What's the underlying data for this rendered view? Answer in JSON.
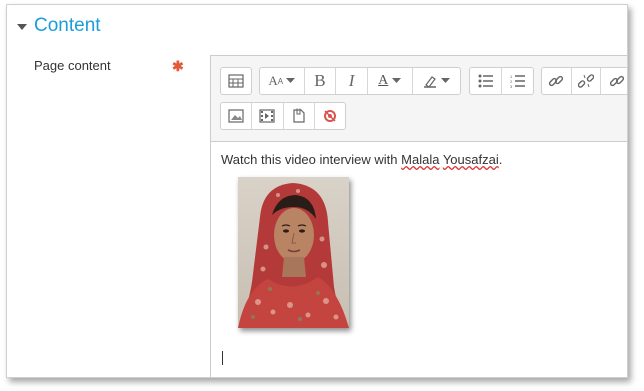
{
  "section": {
    "title": "Content"
  },
  "field": {
    "label": "Page content",
    "required_marker": "✱"
  },
  "toolbar": {
    "row1": [
      {
        "name": "show-more-buttons-icon"
      },
      {
        "name": "font-size-icon",
        "label": "A"
      },
      {
        "name": "bold-icon",
        "label": "B"
      },
      {
        "name": "italic-icon",
        "label": "I"
      },
      {
        "name": "font-color-icon",
        "label": "A"
      },
      {
        "name": "background-color-icon"
      },
      {
        "name": "unordered-list-icon"
      },
      {
        "name": "ordered-list-icon"
      },
      {
        "name": "link-icon"
      },
      {
        "name": "unlink-icon"
      },
      {
        "name": "link-extra-icon"
      }
    ],
    "row2": [
      {
        "name": "insert-image-icon"
      },
      {
        "name": "insert-media-icon"
      },
      {
        "name": "manage-files-icon"
      },
      {
        "name": "record-audio-icon"
      }
    ]
  },
  "editor": {
    "text_before": "Watch this video interview with ",
    "name_first": "Malala",
    "name_space": " ",
    "name_last": "Yousafzai",
    "text_after": "."
  },
  "colors": {
    "accent": "#1a9ed9",
    "required": "#e05a3a"
  }
}
